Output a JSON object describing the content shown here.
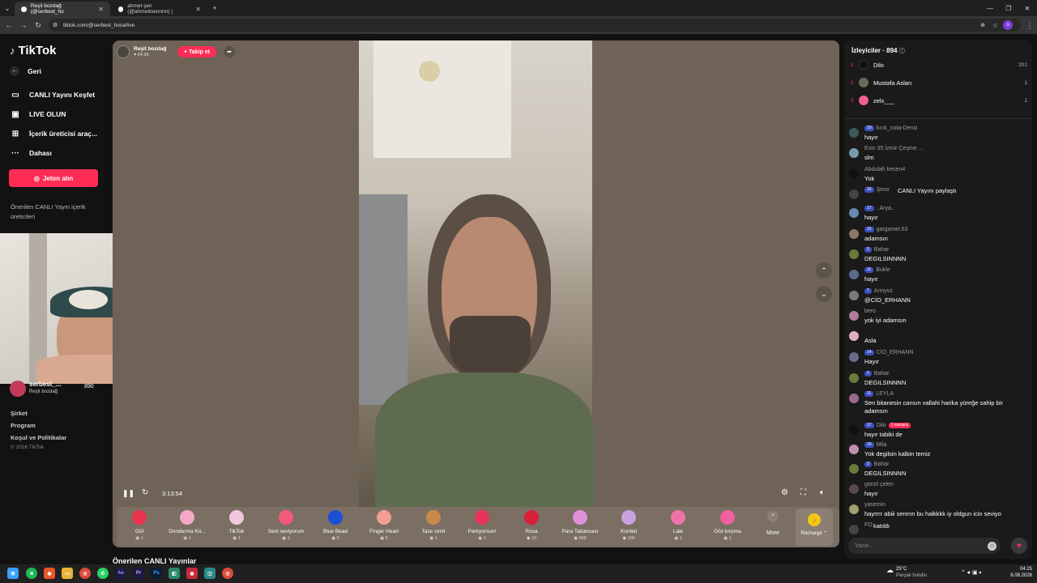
{
  "browser": {
    "tabs": [
      {
        "label": "Reşit bozdağ (@serbest_ho"
      },
      {
        "label": "ahmet şen (@ahmettsennnn) |"
      }
    ],
    "url": "tiktok.com/@serbest_hoca/live",
    "profile_initial": "o"
  },
  "sidebar": {
    "logo": "TikTok",
    "back": "Geri",
    "items": [
      {
        "label": "CANLI Yayını Keşfet",
        "icon": "live-tv-icon"
      },
      {
        "label": "LIVE OLUN",
        "icon": "camera-icon"
      },
      {
        "label": "İçerik üreticisi araç...",
        "icon": "tools-icon"
      },
      {
        "label": "Dahası",
        "icon": "more-icon"
      }
    ],
    "coin_button": "Jeton alın",
    "recommended_title": "Önerilen CANLI Yayın içerik üreticileri",
    "featured_name": "serbest_...",
    "featured_sub": "Reşit bozdağ",
    "featured_count": "890",
    "footer": [
      "Şirket",
      "Program",
      "Koşul ve Politikalar"
    ],
    "copyright": "© 2026 TikTok"
  },
  "video": {
    "host_name": "Reşit bozdağ",
    "host_likes": "84.9K",
    "follow_label": "+ Takip et",
    "time": "3:13:54",
    "below_title": "Önerilen CANLI Yayınlar"
  },
  "gifts": [
    {
      "name": "Gül",
      "price": "1",
      "color": "#e8334f"
    },
    {
      "name": "Dondurma Kü...",
      "price": "1",
      "color": "#f4a8c8"
    },
    {
      "name": "TikTok",
      "price": "1",
      "color": "#f2c6e0"
    },
    {
      "name": "Seni seviyorum",
      "price": "1",
      "color": "#f25a7a"
    },
    {
      "name": "Blue Bead",
      "price": "5",
      "color": "#1a4fd6"
    },
    {
      "name": "Finger Heart",
      "price": "5",
      "color": "#f0a090"
    },
    {
      "name": "Taze simit",
      "price": "1",
      "color": "#c88a4a"
    },
    {
      "name": "Parlıyorsun!",
      "price": "1",
      "color": "#e8335a"
    },
    {
      "name": "Rosa",
      "price": "10",
      "color": "#d8203a"
    },
    {
      "name": "Para Tabancası",
      "price": "500",
      "color": "#e090d8"
    },
    {
      "name": "Konfeti",
      "price": "100",
      "color": "#c9a0e0"
    },
    {
      "name": "Lale",
      "price": "1",
      "color": "#f070a8"
    },
    {
      "name": "Göz kırpma",
      "price": "1",
      "color": "#f060a0"
    }
  ],
  "gift_more": "More",
  "gift_recharge": "Recharge",
  "chat": {
    "viewers_label": "İzleyiciler · 894",
    "ranking": [
      {
        "rank": "1",
        "name": "Dilo",
        "score": "201",
        "color": "#111111"
      },
      {
        "rank": "2",
        "name": "Mustafa Aslan",
        "score": "1",
        "color": "#6a6a5a"
      },
      {
        "rank": "3",
        "name": "zelx___",
        "score": "1",
        "color": "#f06090"
      }
    ],
    "messages": [
      {
        "badge": "19",
        "user": "kırık_nota-Deniz",
        "text": "hayır",
        "color": "#3a5a5a"
      },
      {
        "badge": "",
        "user": "Esin 35 İzmir Çeşme ...",
        "text": "slm",
        "color": "#7a9ab0"
      },
      {
        "badge": "",
        "user": "Abdulah kesen4",
        "text": "Yok",
        "color": "#111111"
      },
      {
        "badge": "16",
        "user": "Şevo",
        "text": "CANLI Yayını paylaştı",
        "color": "#444444"
      },
      {
        "badge": "17",
        "user": "..Arya..",
        "text": "hayır",
        "color": "#6a8ab0"
      },
      {
        "badge": "15",
        "user": "gargamel.63",
        "text": "adamsın",
        "color": "#8a7a6a"
      },
      {
        "badge": "3",
        "user": "Bahar",
        "text": "DEGILSINNNN",
        "color": "#6a7a3a"
      },
      {
        "badge": "11",
        "user": "Bukle",
        "text": "hayır",
        "color": "#5a6a8a"
      },
      {
        "badge": "7",
        "user": "Arinyvz",
        "text": "@CİO_ERHANN",
        "color": "#7a7a7a"
      },
      {
        "badge": "",
        "user": "bero",
        "text": "yok iyi adamsın",
        "color": "#b07a9a"
      },
      {
        "badge": "",
        "user": "",
        "text": "Asla",
        "color": "#e0b0c0"
      },
      {
        "badge": "14",
        "user": "CİO_ERHANN",
        "text": "Hayır",
        "color": "#6a6a8a"
      },
      {
        "badge": "3",
        "user": "Bahar",
        "text": "DEGILSINNNN",
        "color": "#6a7a3a"
      },
      {
        "badge": "11",
        "user": "LEYLA",
        "text": "Sen bitanesin cansın vallahi harika yüreğe sahip bir adamsın",
        "color": "#9a6a8a"
      },
      {
        "badge": "17",
        "user": "Dilo",
        "text": "hayır tabiki de",
        "color": "#111111"
      },
      {
        "badge": "10",
        "user": "Mila",
        "text": "Yok degilsin kalbin temiz",
        "color": "#c090b0"
      },
      {
        "badge": "3",
        "user": "Bahar",
        "text": "DEGILSINNNN",
        "color": "#6a7a3a"
      },
      {
        "badge": "",
        "user": "gönül çelen",
        "text": "hayır",
        "color": "#5a4a4a"
      },
      {
        "badge": "",
        "user": "yasemin",
        "text": "hayrrrr abiii senrnn bu halkkkk iy oldgun icin seviyo",
        "color": "#a0a070"
      },
      {
        "badge": "",
        "user": "FO",
        "text": "katıldı",
        "color": "#444444"
      }
    ],
    "first_badge": "1 numara",
    "input_placeholder": "Yazın..."
  },
  "taskbar": {
    "weather_temp": "25°C",
    "weather_desc": "Parçalı bulutlu",
    "time": "04:25",
    "date": "8.08.2026"
  }
}
